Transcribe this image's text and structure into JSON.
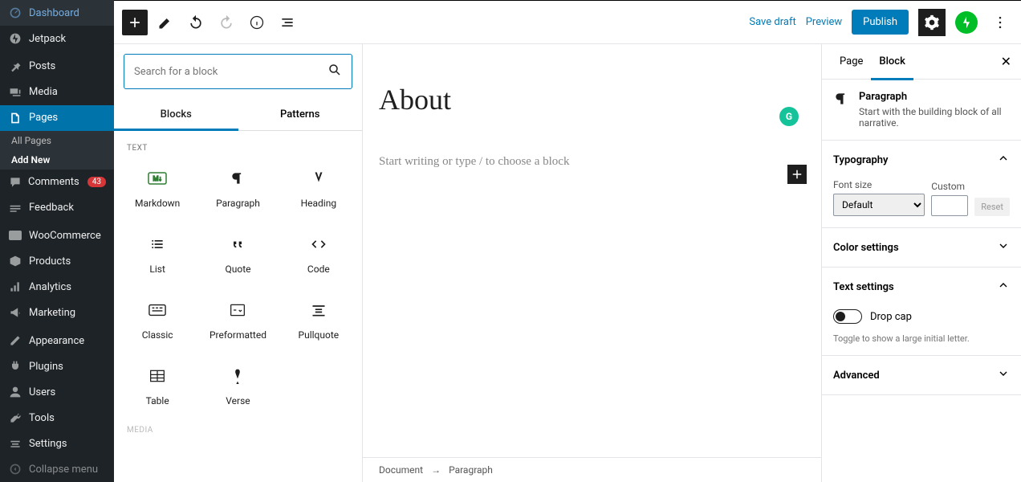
{
  "admin_sidebar": {
    "items": [
      {
        "label": "Dashboard"
      },
      {
        "label": "Jetpack"
      },
      {
        "label": "Posts"
      },
      {
        "label": "Media"
      },
      {
        "label": "Pages",
        "active": true,
        "subitems": [
          {
            "label": "All Pages"
          },
          {
            "label": "Add New",
            "active": true
          }
        ]
      },
      {
        "label": "Comments",
        "badge": "43"
      },
      {
        "label": "Feedback"
      },
      {
        "label": "WooCommerce"
      },
      {
        "label": "Products"
      },
      {
        "label": "Analytics"
      },
      {
        "label": "Marketing"
      },
      {
        "label": "Appearance"
      },
      {
        "label": "Plugins"
      },
      {
        "label": "Users"
      },
      {
        "label": "Tools"
      },
      {
        "label": "Settings"
      },
      {
        "label": "Collapse menu"
      }
    ]
  },
  "toolbar": {
    "save_draft": "Save draft",
    "preview": "Preview",
    "publish": "Publish"
  },
  "inserter": {
    "search_placeholder": "Search for a block",
    "tabs": [
      {
        "label": "Blocks"
      },
      {
        "label": "Patterns"
      }
    ],
    "section_text": "TEXT",
    "section_media": "MEDIA",
    "blocks": [
      {
        "label": "Markdown"
      },
      {
        "label": "Paragraph"
      },
      {
        "label": "Heading"
      },
      {
        "label": "List"
      },
      {
        "label": "Quote"
      },
      {
        "label": "Code"
      },
      {
        "label": "Classic"
      },
      {
        "label": "Preformatted"
      },
      {
        "label": "Pullquote"
      },
      {
        "label": "Table"
      },
      {
        "label": "Verse"
      }
    ]
  },
  "canvas": {
    "title": "About",
    "placeholder": "Start writing or type / to choose a block",
    "breadcrumb": {
      "root": "Document",
      "current": "Paragraph"
    }
  },
  "settings": {
    "tabs": [
      {
        "label": "Page"
      },
      {
        "label": "Block"
      }
    ],
    "block_info": {
      "title": "Paragraph",
      "desc": "Start with the building block of all narrative."
    },
    "typography": {
      "title": "Typography",
      "font_size_label": "Font size",
      "select_value": "Default",
      "custom_label": "Custom",
      "reset": "Reset"
    },
    "color": {
      "title": "Color settings"
    },
    "text": {
      "title": "Text settings",
      "dropcap_label": "Drop cap",
      "dropcap_desc": "Toggle to show a large initial letter."
    },
    "advanced": {
      "title": "Advanced"
    }
  }
}
